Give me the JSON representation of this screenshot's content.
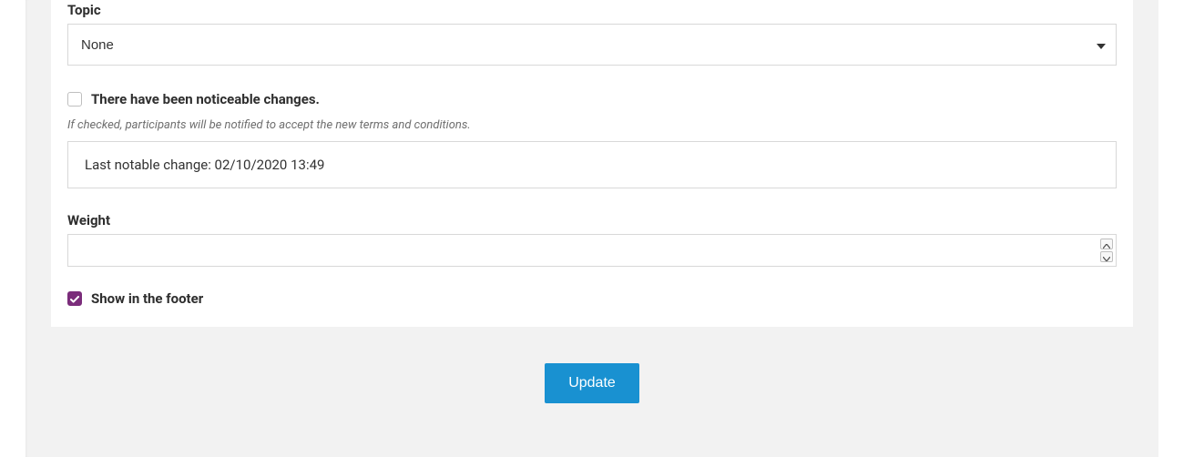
{
  "form": {
    "topic": {
      "label": "Topic",
      "value": "None"
    },
    "changes": {
      "label": "There have been noticeable changes.",
      "hint": "If checked, participants will be notified to accept the new terms and conditions.",
      "info": "Last notable change: 02/10/2020 13:49"
    },
    "weight": {
      "label": "Weight",
      "value": ""
    },
    "footer": {
      "label": "Show in the footer"
    },
    "submit": "Update"
  }
}
